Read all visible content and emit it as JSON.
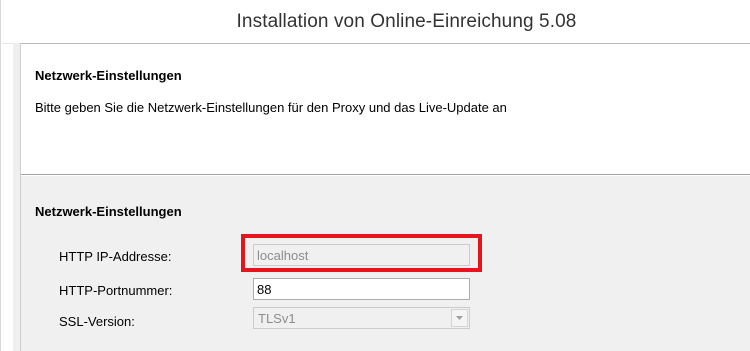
{
  "window": {
    "title": "Installation von Online-Einreichung 5.08"
  },
  "header": {
    "title": "Netzwerk-Einstellungen",
    "description": "Bitte geben Sie die Netzwerk-Einstellungen für den Proxy und das Live-Update an"
  },
  "section": {
    "title": "Netzwerk-Einstellungen",
    "fields": {
      "http_ip": {
        "label": "HTTP IP-Addresse:",
        "value": "localhost",
        "enabled": false
      },
      "http_port": {
        "label": "HTTP-Portnummer:",
        "value": "88",
        "enabled": true
      },
      "ssl_version": {
        "label": "SSL-Version:",
        "value": "TLSv1",
        "enabled": false,
        "icon": "chevron-down-icon"
      }
    }
  },
  "colors": {
    "highlight_border": "#e8141c",
    "content_background": "#f0f0f0",
    "disabled_text": "#8c8c8c"
  }
}
